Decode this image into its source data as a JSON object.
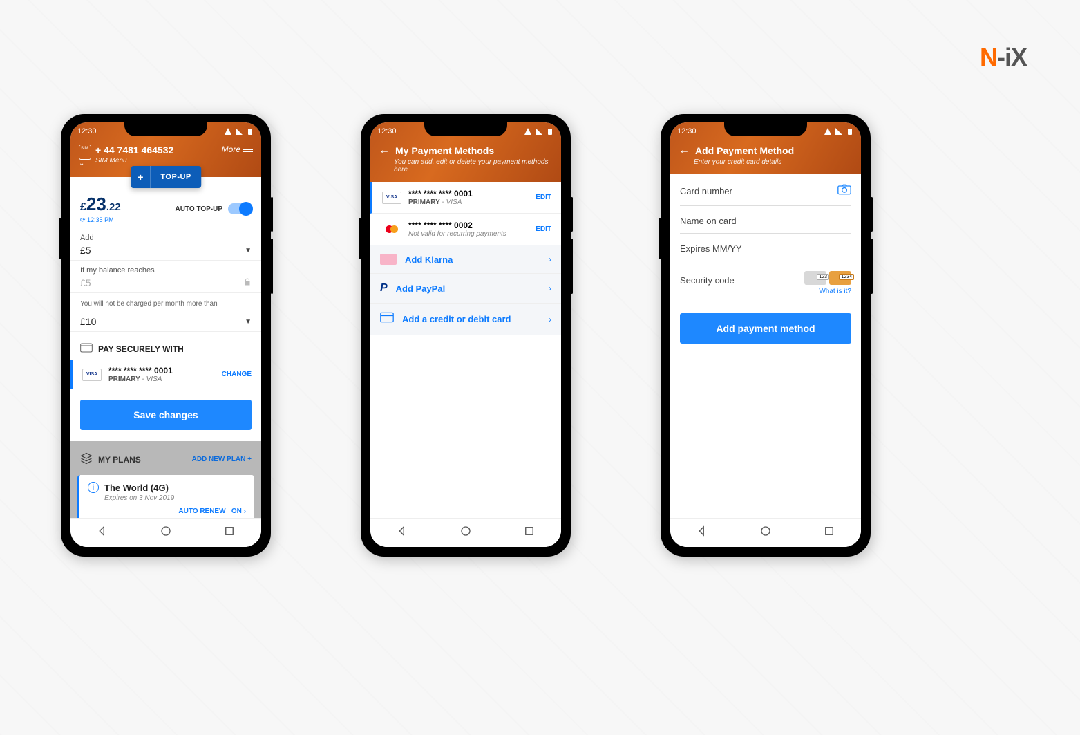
{
  "brand": {
    "n": "N",
    "dash": "-i",
    "x": "X"
  },
  "statusbar": {
    "time": "12:30"
  },
  "screen1": {
    "header": {
      "phone_number": "+ 44 7481 464532",
      "sim_menu": "SIM Menu",
      "more": "More",
      "topup_label": "TOP-UP"
    },
    "balance": {
      "currency": "£",
      "whole": "23",
      "cents": ".22",
      "refreshed": "⟳ 12:35 PM"
    },
    "auto_topup_label": "AUTO TOP-UP",
    "fields": {
      "add_label": "Add",
      "add_value": "£5",
      "threshold_label": "If my balance reaches",
      "threshold_value": "£5",
      "cap_note": "You will not be charged per month more than",
      "cap_value": "£10"
    },
    "pay_with_label": "PAY SECURELY WITH",
    "card": {
      "masked": "**** **** **** 0001",
      "primary": "PRIMARY",
      "type": " - VISA",
      "change": "CHANGE"
    },
    "save_btn": "Save changes",
    "plans": {
      "title": "MY PLANS",
      "add_new": "ADD NEW PLAN  +",
      "plan_name": "The World (4G)",
      "plan_expires": "Expires on 3 Nov 2019",
      "auto_renew_label": "AUTO RENEW",
      "auto_renew_state": "ON ›"
    }
  },
  "screen2": {
    "title": "My Payment Methods",
    "subtitle": "You can add, edit or delete your payment methods here",
    "cards": [
      {
        "masked": "**** **** **** 0001",
        "primary": "PRIMARY",
        "type": " - VISA",
        "edit": "EDIT"
      },
      {
        "masked": "**** **** **** 0002",
        "note": "Not valid for recurring payments",
        "edit": "EDIT"
      }
    ],
    "options": {
      "klarna": "Add Klarna",
      "paypal": "Add PayPal",
      "cc": "Add a credit or debit card"
    }
  },
  "screen3": {
    "title": "Add Payment Method",
    "subtitle": "Enter your credit card details",
    "fields": {
      "card_number": "Card number",
      "name": "Name on card",
      "expires": "Expires MM/YY",
      "security": "Security code",
      "whatis": "What is it?"
    },
    "btn": "Add payment method"
  }
}
